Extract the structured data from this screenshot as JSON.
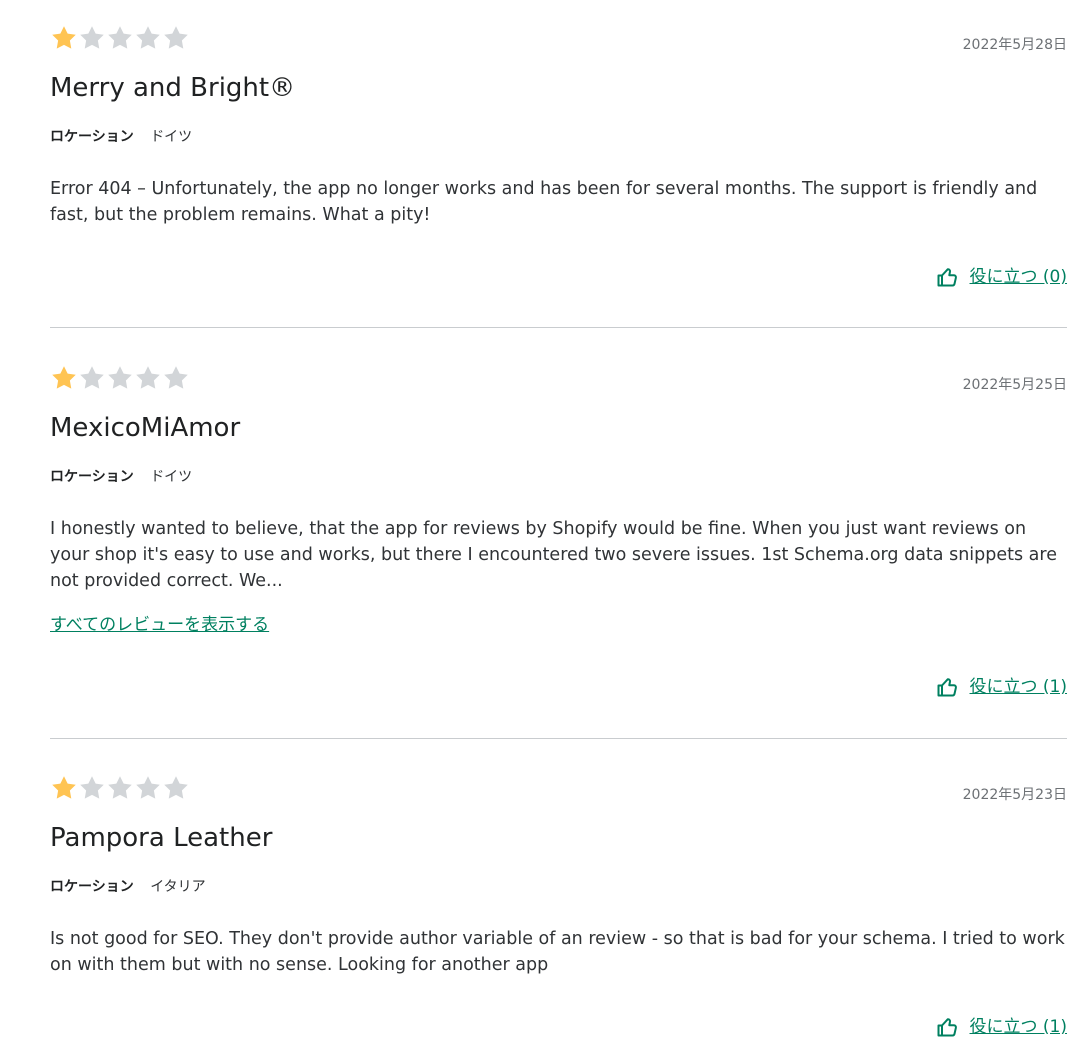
{
  "reviews": [
    {
      "rating": 1,
      "max_rating": 5,
      "date": "2022年5月28日",
      "author": "Merry and Bright®",
      "location_label": "ロケーション",
      "location": "ドイツ",
      "body": "Error 404 – Unfortunately, the app no longer works and has been for several months. The support is friendly and fast, but the problem remains. What a pity!",
      "helpful": "役に立つ (0)"
    },
    {
      "rating": 1,
      "max_rating": 5,
      "date": "2022年5月25日",
      "author": "MexicoMiAmor",
      "location_label": "ロケーション",
      "location": "ドイツ",
      "body": "I honestly wanted to believe, that the app for reviews by Shopify would be fine. When you just want reviews on your shop it's easy to use and works, but there I encountered two severe issues. 1st Schema.org data snippets are not provided correct. We...",
      "show_all": "すべてのレビューを表示する",
      "helpful": "役に立つ (1)"
    },
    {
      "rating": 1,
      "max_rating": 5,
      "date": "2022年5月23日",
      "author": "Pampora Leather",
      "location_label": "ロケーション",
      "location": "イタリア",
      "body": "Is not good for SEO. They don't provide author variable of an review - so that is bad for your schema. I tried to work on with them but with no sense. Looking for another app",
      "helpful": "役に立つ (1)"
    }
  ],
  "colors": {
    "star_filled": "#ffc453",
    "star_empty": "#d2d5d8",
    "link": "#008060",
    "divider": "#c9cccf"
  },
  "icons": {
    "star": "star-icon",
    "helpful": "thumbs-up-icon"
  }
}
